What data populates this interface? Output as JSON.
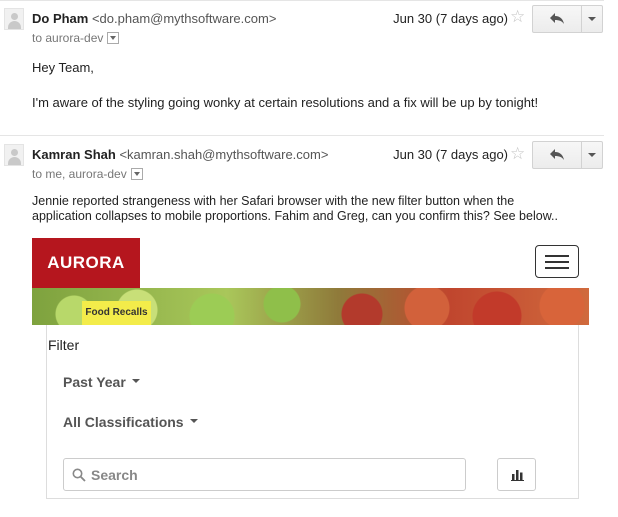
{
  "messages": [
    {
      "sender_name": "Do Pham",
      "sender_email": "<do.pham@mythsoftware.com>",
      "to_line": "to aurora-dev",
      "date": "Jun 30 (7 days ago)",
      "body_lines": [
        "Hey Team,",
        "I'm aware of the styling going wonky at certain resolutions and a fix will be up by tonight!"
      ]
    },
    {
      "sender_name": "Kamran Shah",
      "sender_email": "<kamran.shah@mythsoftware.com>",
      "to_line": "to me, aurora-dev",
      "date": "Jun 30 (7 days ago)",
      "body_lines": [
        "Jennie reported strangeness with her Safari browser with the new filter button when the",
        "application collapses to mobile proportions.  Fahim and Greg, can you confirm this?  See below.."
      ]
    }
  ],
  "embedded_app": {
    "logo_text": "AURORA",
    "banner_tag": "Food Recalls",
    "filter_label": "Filter",
    "time_filter": "Past Year",
    "classification_filter": "All Classifications",
    "search_placeholder": "Search"
  },
  "icons": {
    "star": "star-icon",
    "reply": "reply-icon",
    "more": "chevron-down-icon",
    "menu": "hamburger-menu-icon",
    "search": "search-icon",
    "chart": "bar-chart-icon"
  },
  "colors": {
    "brand_red": "#b5161e",
    "tag_yellow": "#f3ec4a"
  }
}
